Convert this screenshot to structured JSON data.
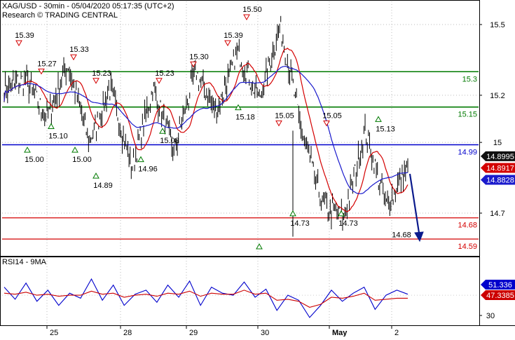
{
  "header": {
    "title": "XAG/USD - 30min - 05/04/2020 05:17:35 (UTC+2)",
    "subtitle": "Research © TRADING CENTRAL"
  },
  "colors": {
    "price": "#000000",
    "ma_fast": "#d40000",
    "ma_slow": "#1a1acc",
    "resistance": "#007a00",
    "pivot": "#0000cc",
    "support": "#d40000",
    "arrow": "#0a1a8c",
    "rsi": "#0000cc",
    "rsi_ma": "#cc0000"
  },
  "chart_data": [
    {
      "type": "line",
      "name": "price-panel",
      "x": [
        "25",
        "28",
        "29",
        "30",
        "May",
        "2"
      ],
      "series": [
        {
          "values": [
            15.22,
            15.27,
            15.1,
            15.33,
            15.0,
            15.23,
            14.89,
            15.23,
            14.96,
            15.3,
            15.13,
            15.39,
            15.18,
            15.5,
            15.05,
            14.73,
            14.68,
            15.05,
            14.73,
            14.9
          ]
        }
      ],
      "ylim": [
        14.58,
        15.56
      ],
      "yticks": [
        15.5,
        15.2,
        15.0,
        14.7
      ],
      "xticks": [
        "25",
        "28",
        "29",
        "30",
        "May",
        "2"
      ],
      "levels": [
        {
          "label": "15.3",
          "value": 15.3,
          "kind": "resistance"
        },
        {
          "label": "15.15",
          "value": 15.15,
          "kind": "resistance"
        },
        {
          "label": "14.99",
          "value": 14.99,
          "kind": "pivot"
        },
        {
          "label": "14.68",
          "value": 14.68,
          "kind": "support"
        },
        {
          "label": "14.59",
          "value": 14.59,
          "kind": "support"
        }
      ],
      "last_values": [
        {
          "label": "14.8995",
          "value": 14.8995,
          "kind": "price"
        },
        {
          "label": "14.8917",
          "value": 14.8917,
          "kind": "ma_fast"
        },
        {
          "label": "14.8828",
          "value": 14.8828,
          "kind": "ma_slow"
        }
      ],
      "annotations": [
        {
          "label": "15.39",
          "value": 15.39,
          "kind": "high"
        },
        {
          "label": "15.27",
          "value": 15.27,
          "kind": "high"
        },
        {
          "label": "15.33",
          "value": 15.33,
          "kind": "high"
        },
        {
          "label": "15.23",
          "value": 15.23,
          "kind": "high"
        },
        {
          "label": "15.23",
          "value": 15.23,
          "kind": "high"
        },
        {
          "label": "15.30",
          "value": 15.3,
          "kind": "high"
        },
        {
          "label": "15.39",
          "value": 15.39,
          "kind": "high"
        },
        {
          "label": "15.50",
          "value": 15.5,
          "kind": "high"
        },
        {
          "label": "15.05",
          "value": 15.05,
          "kind": "high"
        },
        {
          "label": "15.05",
          "value": 15.05,
          "kind": "high"
        },
        {
          "label": "15.13",
          "value": 15.13,
          "kind": "low"
        },
        {
          "label": "15.10",
          "value": 15.1,
          "kind": "low"
        },
        {
          "label": "15.00",
          "value": 15.0,
          "kind": "low"
        },
        {
          "label": "15.00",
          "value": 15.0,
          "kind": "low"
        },
        {
          "label": "14.89",
          "value": 14.89,
          "kind": "low"
        },
        {
          "label": "14.96",
          "value": 14.96,
          "kind": "low"
        },
        {
          "label": "15.08",
          "value": 15.08,
          "kind": "low"
        },
        {
          "label": "15.18",
          "value": 15.18,
          "kind": "low"
        },
        {
          "label": "",
          "value": 14.59,
          "kind": "low"
        },
        {
          "label": "14.73",
          "value": 14.73,
          "kind": "low"
        },
        {
          "label": "14.73",
          "value": 14.73,
          "kind": "low"
        },
        {
          "label": "14.68",
          "value": 14.68,
          "kind": "target"
        }
      ]
    },
    {
      "type": "line",
      "name": "rsi-panel",
      "title": "RSI14 - 9MA",
      "series": [
        {
          "values": [
            58,
            46,
            62,
            44,
            55,
            40,
            52,
            47,
            66,
            45,
            60,
            40,
            51,
            55,
            43,
            60,
            48,
            64,
            40,
            58,
            52,
            50,
            63,
            48,
            56,
            35,
            50,
            45,
            28,
            40,
            55,
            44,
            52,
            58,
            36,
            50,
            55,
            51
          ]
        },
        {
          "values": [
            52,
            51,
            53,
            50,
            51,
            49,
            50,
            50,
            54,
            51,
            52,
            48,
            50,
            51,
            49,
            52,
            51,
            54,
            49,
            52,
            51,
            51,
            55,
            51,
            52,
            45,
            46,
            44,
            38,
            41,
            48,
            47,
            49,
            52,
            45,
            46,
            47,
            47
          ]
        }
      ],
      "ylim": [
        25,
        75
      ],
      "yticks": [
        30
      ],
      "last_values": [
        {
          "label": "51.336",
          "value": 51.336,
          "kind": "rsi"
        },
        {
          "label": "47.3385",
          "value": 47.3385,
          "kind": "rsi_ma"
        }
      ]
    }
  ]
}
